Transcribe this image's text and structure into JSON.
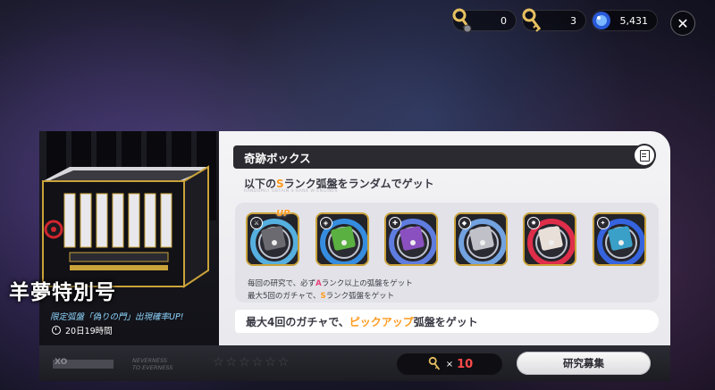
{
  "currencies": [
    {
      "icon": "gold-key-with-gear-icon",
      "value": "0"
    },
    {
      "icon": "gold-key-icon",
      "value": "3"
    },
    {
      "icon": "blue-polychrome-orb-icon",
      "value": "5,431"
    }
  ],
  "close_label": "✕",
  "pack": {
    "title": "羊夢特別号",
    "subtitle": "限定弧盤「偽りの門」出現確率UP!",
    "timer": "20日19時間"
  },
  "card": {
    "header": "奇跡ボックス",
    "desc_prefix": "以下の",
    "desc_rank": "S",
    "desc_suffix": "ランク弧盤をランダムでゲット",
    "desc_small": "RANDOMLY OBTAIN S-RANK W-ENGINES",
    "discs": [
      {
        "name": "disc-1",
        "rank_icon": "attack-icon",
        "glow": "#5ec8ff",
        "core": "#6a6a70",
        "up": true
      },
      {
        "name": "disc-2",
        "rank_icon": "anomaly-icon",
        "glow": "#3aa0ff",
        "core": "#5ab040",
        "up": false
      },
      {
        "name": "disc-3",
        "rank_icon": "support-icon",
        "glow": "#6a8cff",
        "core": "#8a50c0",
        "up": false
      },
      {
        "name": "disc-4",
        "rank_icon": "defense-icon",
        "glow": "#80b8ff",
        "core": "#c0c0c8",
        "up": false
      },
      {
        "name": "disc-5",
        "rank_icon": "stun-icon",
        "glow": "#ff3050",
        "core": "#e8e0d8",
        "up": false
      },
      {
        "name": "disc-6",
        "rank_icon": "rupture-icon",
        "glow": "#3a70ff",
        "core": "#3aa0c8",
        "up": false
      }
    ],
    "up_label": "UP",
    "rule1_prefix": "毎回の研究で、必ず",
    "rule1_rank": "A",
    "rule1_suffix": "ランク以上の弧盤をゲット",
    "rule2_prefix": "最大5回のガチャで、",
    "rule2_rank": "S",
    "rule2_suffix": "ランク弧盤をゲット",
    "pickup_prefix": "最大4回のガチャで、",
    "pickup_highlight": "ピックアップ",
    "pickup_suffix": "弧盤をゲット"
  },
  "bottom": {
    "logo_text": "XO",
    "slogan_line1": "NEVERNESS",
    "slogan_line2": "TO EVERNESS",
    "stars": "☆☆☆☆☆☆",
    "cost_multiplier": "×",
    "cost_value": "10",
    "recruit_label": "研究募集"
  },
  "colors": {
    "accent_orange": "#ff9a1f",
    "rank_a_pink": "#e8407a",
    "cost_red": "#ff4a4a",
    "disc_border_gold": "#caa23a"
  }
}
